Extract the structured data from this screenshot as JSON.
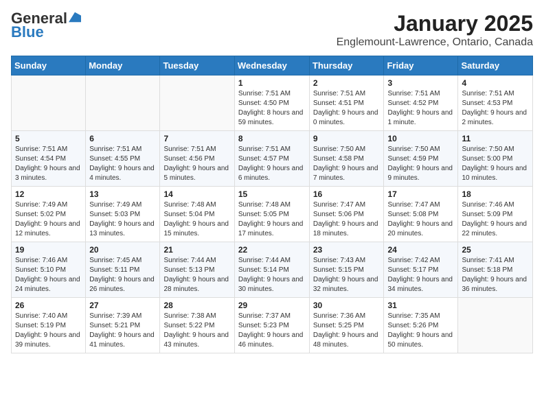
{
  "logo": {
    "general": "General",
    "blue": "Blue"
  },
  "header": {
    "title": "January 2025",
    "subtitle": "Englemount-Lawrence, Ontario, Canada"
  },
  "weekdays": [
    "Sunday",
    "Monday",
    "Tuesday",
    "Wednesday",
    "Thursday",
    "Friday",
    "Saturday"
  ],
  "weeks": [
    [
      {
        "day": "",
        "info": ""
      },
      {
        "day": "",
        "info": ""
      },
      {
        "day": "",
        "info": ""
      },
      {
        "day": "1",
        "info": "Sunrise: 7:51 AM\nSunset: 4:50 PM\nDaylight: 8 hours and 59 minutes."
      },
      {
        "day": "2",
        "info": "Sunrise: 7:51 AM\nSunset: 4:51 PM\nDaylight: 9 hours and 0 minutes."
      },
      {
        "day": "3",
        "info": "Sunrise: 7:51 AM\nSunset: 4:52 PM\nDaylight: 9 hours and 1 minute."
      },
      {
        "day": "4",
        "info": "Sunrise: 7:51 AM\nSunset: 4:53 PM\nDaylight: 9 hours and 2 minutes."
      }
    ],
    [
      {
        "day": "5",
        "info": "Sunrise: 7:51 AM\nSunset: 4:54 PM\nDaylight: 9 hours and 3 minutes."
      },
      {
        "day": "6",
        "info": "Sunrise: 7:51 AM\nSunset: 4:55 PM\nDaylight: 9 hours and 4 minutes."
      },
      {
        "day": "7",
        "info": "Sunrise: 7:51 AM\nSunset: 4:56 PM\nDaylight: 9 hours and 5 minutes."
      },
      {
        "day": "8",
        "info": "Sunrise: 7:51 AM\nSunset: 4:57 PM\nDaylight: 9 hours and 6 minutes."
      },
      {
        "day": "9",
        "info": "Sunrise: 7:50 AM\nSunset: 4:58 PM\nDaylight: 9 hours and 7 minutes."
      },
      {
        "day": "10",
        "info": "Sunrise: 7:50 AM\nSunset: 4:59 PM\nDaylight: 9 hours and 9 minutes."
      },
      {
        "day": "11",
        "info": "Sunrise: 7:50 AM\nSunset: 5:00 PM\nDaylight: 9 hours and 10 minutes."
      }
    ],
    [
      {
        "day": "12",
        "info": "Sunrise: 7:49 AM\nSunset: 5:02 PM\nDaylight: 9 hours and 12 minutes."
      },
      {
        "day": "13",
        "info": "Sunrise: 7:49 AM\nSunset: 5:03 PM\nDaylight: 9 hours and 13 minutes."
      },
      {
        "day": "14",
        "info": "Sunrise: 7:48 AM\nSunset: 5:04 PM\nDaylight: 9 hours and 15 minutes."
      },
      {
        "day": "15",
        "info": "Sunrise: 7:48 AM\nSunset: 5:05 PM\nDaylight: 9 hours and 17 minutes."
      },
      {
        "day": "16",
        "info": "Sunrise: 7:47 AM\nSunset: 5:06 PM\nDaylight: 9 hours and 18 minutes."
      },
      {
        "day": "17",
        "info": "Sunrise: 7:47 AM\nSunset: 5:08 PM\nDaylight: 9 hours and 20 minutes."
      },
      {
        "day": "18",
        "info": "Sunrise: 7:46 AM\nSunset: 5:09 PM\nDaylight: 9 hours and 22 minutes."
      }
    ],
    [
      {
        "day": "19",
        "info": "Sunrise: 7:46 AM\nSunset: 5:10 PM\nDaylight: 9 hours and 24 minutes."
      },
      {
        "day": "20",
        "info": "Sunrise: 7:45 AM\nSunset: 5:11 PM\nDaylight: 9 hours and 26 minutes."
      },
      {
        "day": "21",
        "info": "Sunrise: 7:44 AM\nSunset: 5:13 PM\nDaylight: 9 hours and 28 minutes."
      },
      {
        "day": "22",
        "info": "Sunrise: 7:44 AM\nSunset: 5:14 PM\nDaylight: 9 hours and 30 minutes."
      },
      {
        "day": "23",
        "info": "Sunrise: 7:43 AM\nSunset: 5:15 PM\nDaylight: 9 hours and 32 minutes."
      },
      {
        "day": "24",
        "info": "Sunrise: 7:42 AM\nSunset: 5:17 PM\nDaylight: 9 hours and 34 minutes."
      },
      {
        "day": "25",
        "info": "Sunrise: 7:41 AM\nSunset: 5:18 PM\nDaylight: 9 hours and 36 minutes."
      }
    ],
    [
      {
        "day": "26",
        "info": "Sunrise: 7:40 AM\nSunset: 5:19 PM\nDaylight: 9 hours and 39 minutes."
      },
      {
        "day": "27",
        "info": "Sunrise: 7:39 AM\nSunset: 5:21 PM\nDaylight: 9 hours and 41 minutes."
      },
      {
        "day": "28",
        "info": "Sunrise: 7:38 AM\nSunset: 5:22 PM\nDaylight: 9 hours and 43 minutes."
      },
      {
        "day": "29",
        "info": "Sunrise: 7:37 AM\nSunset: 5:23 PM\nDaylight: 9 hours and 46 minutes."
      },
      {
        "day": "30",
        "info": "Sunrise: 7:36 AM\nSunset: 5:25 PM\nDaylight: 9 hours and 48 minutes."
      },
      {
        "day": "31",
        "info": "Sunrise: 7:35 AM\nSunset: 5:26 PM\nDaylight: 9 hours and 50 minutes."
      },
      {
        "day": "",
        "info": ""
      }
    ]
  ]
}
